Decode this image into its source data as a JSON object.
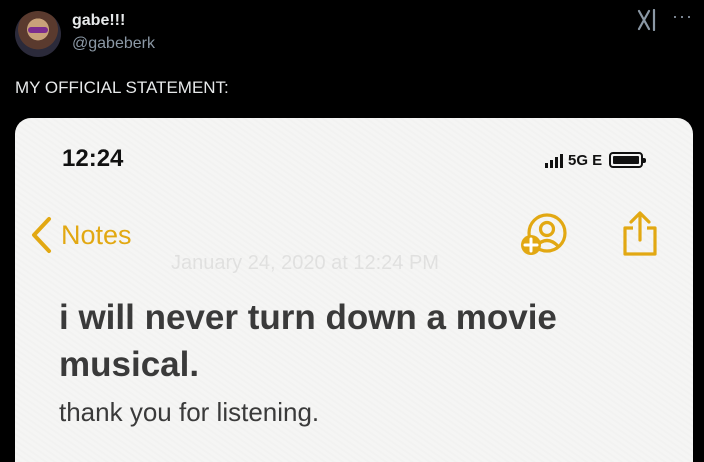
{
  "tweet": {
    "display_name": "gabe!!!",
    "handle": "@gabeberk",
    "text": "MY OFFICIAL STATEMENT:",
    "brand_icon": "grok-icon",
    "more_icon": "more-icon",
    "more_glyph": "···"
  },
  "phone": {
    "time": "12:24",
    "network": "5G E",
    "back_label": "Notes",
    "date_ghost": "January 24, 2020 at 12:24 PM",
    "note_title": "i will never turn down a movie musical.",
    "note_body": "thank you for listening."
  },
  "colors": {
    "accent": "#e2a812",
    "background": "#000000",
    "note_paper": "#f5f5f4"
  }
}
